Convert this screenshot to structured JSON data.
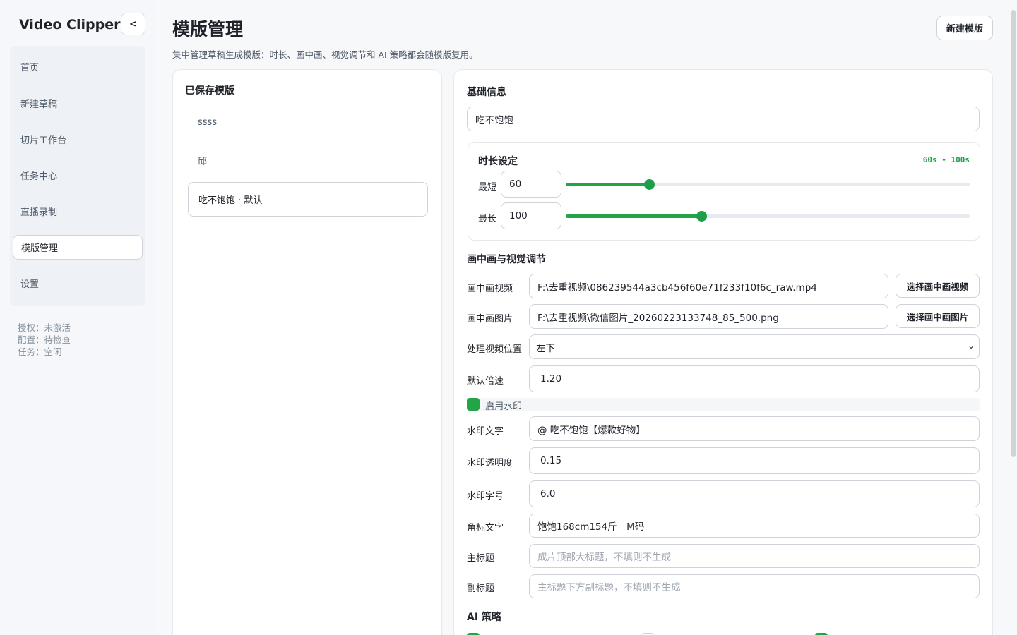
{
  "app": {
    "title": "Video Clipper",
    "collapse_label": "<"
  },
  "sidebar": {
    "items": [
      {
        "label": "首页"
      },
      {
        "label": "新建草稿"
      },
      {
        "label": "切片工作台"
      },
      {
        "label": "任务中心"
      },
      {
        "label": "直播录制"
      },
      {
        "label": "模版管理",
        "active": true
      },
      {
        "label": "设置"
      }
    ],
    "status": {
      "license": "授权：未激活",
      "config": "配置：待检查",
      "task": "任务：空闲"
    }
  },
  "header": {
    "title": "模版管理",
    "description": "集中管理草稿生成模版：时长、画中画、视觉调节和 AI 策略都会随模版复用。",
    "new_button": "新建模版"
  },
  "templates": {
    "heading": "已保存模版",
    "items": [
      {
        "label": "ssss"
      },
      {
        "label": "邱"
      },
      {
        "label": "吃不饱饱 · 默认",
        "selected": true
      }
    ]
  },
  "editor": {
    "basic_heading": "基础信息",
    "name_value": "吃不饱饱",
    "duration": {
      "heading": "时长设定",
      "range_text": "60s - 100s",
      "min_label": "最短",
      "min_value": "60",
      "max_label": "最长",
      "max_value": "100",
      "min_fraction": 0.206,
      "max_fraction": 0.336
    },
    "pip_heading": "画中画与视觉调节",
    "pip_video_label": "画中画视频",
    "pip_video_value": "F:\\去重视频\\086239544a3cb456f60e71f233f10f6c_raw.mp4",
    "pip_video_button": "选择画中画视频",
    "pip_image_label": "画中画图片",
    "pip_image_value": "F:\\去重视频\\微信图片_20260223133748_85_500.png",
    "pip_image_button": "选择画中画图片",
    "position_label": "处理视频位置",
    "position_value": "左下",
    "speed_label": "默认倍速",
    "speed_value": "1.20",
    "watermark_enabled_label": "启用水印",
    "watermark_text_label": "水印文字",
    "watermark_text_value": "@ 吃不饱饱【爆款好物】",
    "watermark_opacity_label": "水印透明度",
    "watermark_opacity_value": "0.15",
    "watermark_size_label": "水印字号",
    "watermark_size_value": "6.0",
    "corner_label": "角标文字",
    "corner_value": "饱饱168cm154斤　M码",
    "main_title_label": "主标题",
    "main_title_placeholder": "成片顶部大标题，不填则不生成",
    "sub_title_label": "副标题",
    "sub_title_placeholder": "主标题下方副标题，不填则不生成",
    "ai_heading": "AI 策略"
  },
  "colors": {
    "accent": "#22a447",
    "accent_text": "#1e9e4a"
  }
}
